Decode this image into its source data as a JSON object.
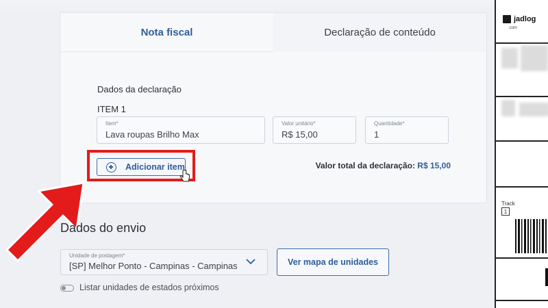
{
  "tabs": {
    "nota_fiscal": "Nota fiscal",
    "declaracao": "Declaração de conteúdo"
  },
  "declaracao": {
    "section_title": "Dados da declaração",
    "item_title": "ITEM 1",
    "item": {
      "label": "Item*",
      "value": "Lava roupas Brilho Max"
    },
    "valor": {
      "label": "Valor unitário*",
      "value": "R$ 15,00"
    },
    "quantidade": {
      "label": "Quantidade*",
      "value": "1"
    },
    "add_button": "Adicionar item",
    "total_label": "Valor total da declaração:",
    "total_value": "R$ 15,00"
  },
  "envio": {
    "title": "Dados do envio",
    "unidade": {
      "label": "Unidade de postagem*",
      "value": "[SP] Melhor Ponto - Campinas - Campinas"
    },
    "map_button": "Ver mapa de unidades",
    "toggle_label": "Listar unidades de estados próximos"
  },
  "label_preview": {
    "brand": "jadlog",
    "brand_sub": ".com",
    "track_label": "Track",
    "track_number": "1"
  },
  "colors": {
    "accent": "#2f5d9a",
    "highlight": "#e31b1b"
  }
}
